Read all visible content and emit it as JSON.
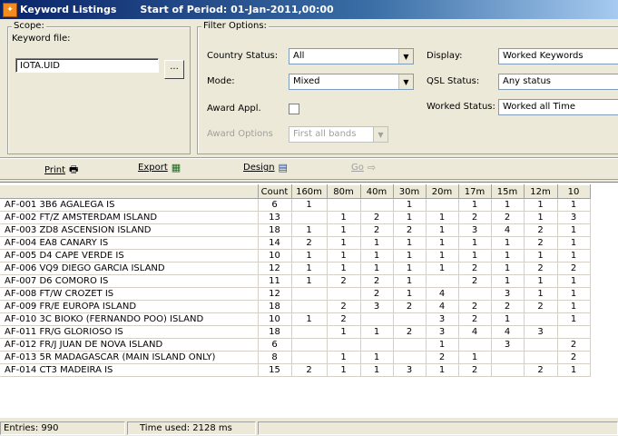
{
  "title": {
    "app": "Keyword Listings",
    "period": "Start of Period: 01-Jan-2011,00:00",
    "icon": "app-logo-icon"
  },
  "scope": {
    "legend": "Scope:",
    "keyword_file_label": "Keyword file:",
    "keyword_file_value": "IOTA.UID",
    "browse_label": "..."
  },
  "filter": {
    "legend": "Filter Options:",
    "country_status_label": "Country Status:",
    "country_status_value": "All",
    "mode_label": "Mode:",
    "mode_value": "Mixed",
    "award_appl_label": "Award Appl.",
    "award_appl_checked": false,
    "award_options_label": "Award Options",
    "award_options_value": "First all bands",
    "display_label": "Display:",
    "display_value": "Worked Keywords",
    "qsl_status_label": "QSL Status:",
    "qsl_status_value": "Any status",
    "worked_status_label": "Worked Status:",
    "worked_status_value": "Worked all Time"
  },
  "toolbar": {
    "print": "Print",
    "export": "Export",
    "design": "Design",
    "goto": "Go"
  },
  "grid": {
    "columns": [
      "",
      "Count",
      "160m",
      "80m",
      "40m",
      "30m",
      "20m",
      "17m",
      "15m",
      "12m",
      "10"
    ],
    "rows": [
      [
        "AF-001 3B6   AGALEGA IS",
        "6",
        "1",
        "",
        "",
        "1",
        "",
        "1",
        "1",
        "1",
        "1"
      ],
      [
        "AF-002 FT/Z   AMSTERDAM ISLAND",
        "13",
        "",
        "1",
        "2",
        "1",
        "1",
        "2",
        "2",
        "1",
        "3"
      ],
      [
        "AF-003 ZD8   ASCENSION ISLAND",
        "18",
        "1",
        "1",
        "2",
        "2",
        "1",
        "3",
        "4",
        "2",
        "1"
      ],
      [
        "AF-004 EA8   CANARY IS",
        "14",
        "2",
        "1",
        "1",
        "1",
        "1",
        "1",
        "1",
        "2",
        "1"
      ],
      [
        "AF-005 D4   CAPE VERDE IS",
        "10",
        "1",
        "1",
        "1",
        "1",
        "1",
        "1",
        "1",
        "1",
        "1"
      ],
      [
        "AF-006 VQ9   DIEGO GARCIA ISLAND",
        "12",
        "1",
        "1",
        "1",
        "1",
        "1",
        "2",
        "1",
        "2",
        "2"
      ],
      [
        "AF-007 D6   COMORO IS",
        "11",
        "1",
        "2",
        "2",
        "1",
        "",
        "2",
        "1",
        "1",
        "1"
      ],
      [
        "AF-008 FT/W   CROZET IS",
        "12",
        "",
        "",
        "2",
        "1",
        "4",
        "",
        "3",
        "1",
        "1"
      ],
      [
        "AF-009 FR/E   EUROPA ISLAND",
        "18",
        "",
        "2",
        "3",
        "2",
        "4",
        "2",
        "2",
        "2",
        "1"
      ],
      [
        "AF-010 3C   BIOKO (FERNANDO POO) ISLAND",
        "10",
        "1",
        "2",
        "",
        "",
        "3",
        "2",
        "1",
        "",
        "1"
      ],
      [
        "AF-011 FR/G   GLORIOSO IS",
        "18",
        "",
        "1",
        "1",
        "2",
        "3",
        "4",
        "4",
        "3",
        ""
      ],
      [
        "AF-012 FR/J   JUAN DE NOVA ISLAND",
        "6",
        "",
        "",
        "",
        "",
        "1",
        "",
        "3",
        "",
        "2"
      ],
      [
        "AF-013 5R   MADAGASCAR (MAIN ISLAND ONLY)",
        "8",
        "",
        "1",
        "1",
        "",
        "2",
        "1",
        "",
        "",
        "2"
      ],
      [
        "AF-014 CT3   MADEIRA IS",
        "15",
        "2",
        "1",
        "1",
        "3",
        "1",
        "2",
        "",
        "2",
        "1"
      ]
    ]
  },
  "status": {
    "entries": "Entries: 990",
    "time_used": "Time used: 2128 ms"
  }
}
